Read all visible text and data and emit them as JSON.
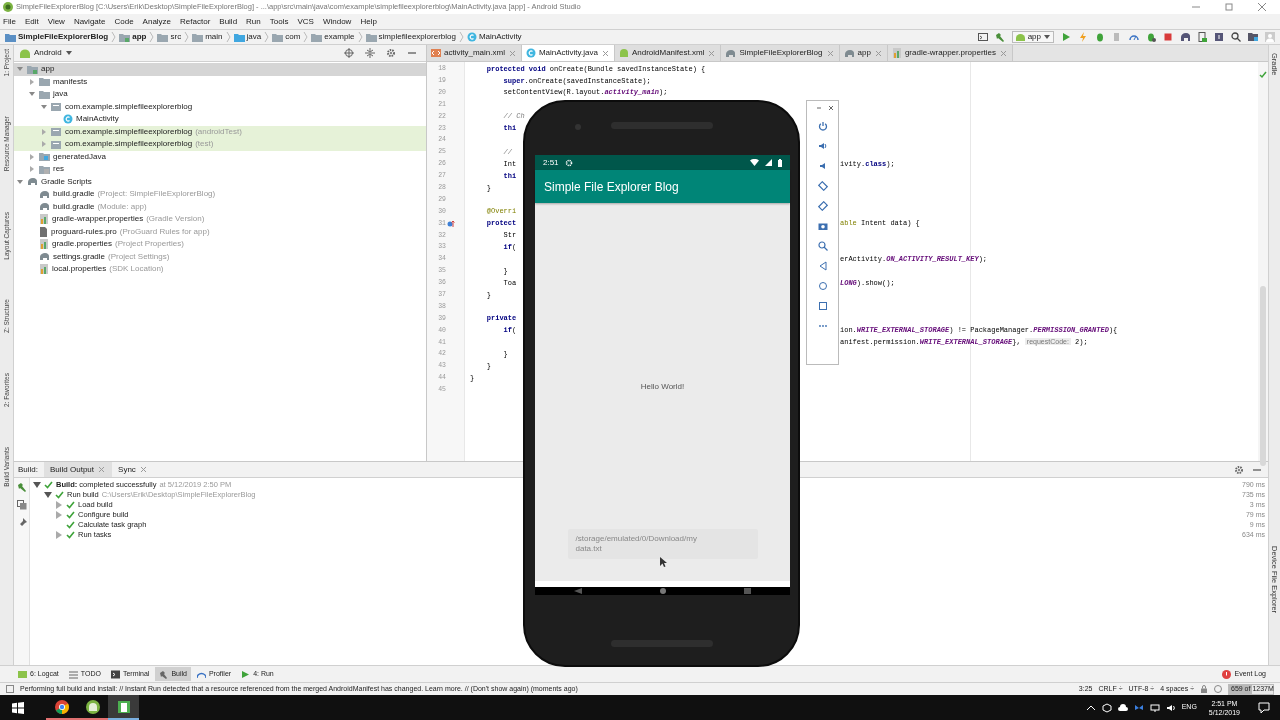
{
  "window": {
    "title": "SimpleFileExplorerBlog [C:\\Users\\Erik\\Desktop\\SimpleFileExplorerBlog] - ...\\app\\src\\main\\java\\com\\example\\simplefileexplorerblog\\MainActivity.java [app] - Android Studio"
  },
  "menu": [
    "File",
    "Edit",
    "View",
    "Navigate",
    "Code",
    "Analyze",
    "Refactor",
    "Build",
    "Run",
    "Tools",
    "VCS",
    "Window",
    "Help"
  ],
  "breadcrumb": [
    {
      "label": "SimpleFileExplorerBlog",
      "kind": "project"
    },
    {
      "label": "app",
      "kind": "module"
    },
    {
      "label": "src",
      "kind": "folder"
    },
    {
      "label": "main",
      "kind": "folder"
    },
    {
      "label": "java",
      "kind": "source"
    },
    {
      "label": "com",
      "kind": "folder"
    },
    {
      "label": "example",
      "kind": "folder"
    },
    {
      "label": "simplefileexplorerblog",
      "kind": "folder"
    },
    {
      "label": "MainActivity",
      "kind": "class"
    }
  ],
  "run_config": "app",
  "left_strip": [
    "1: Project",
    "Resource Manager",
    "Layout Captures",
    "Z: Structure",
    "2: Favorites",
    "Build Variants"
  ],
  "right_strip": [
    "Gradle",
    "Device File Explorer"
  ],
  "project": {
    "view": "Android",
    "tree": [
      {
        "label": "app",
        "kind": "module",
        "selected": true,
        "highlighted": false,
        "expanded": true,
        "children": [
          {
            "label": "manifests",
            "kind": "folder",
            "selected": false,
            "highlighted": false,
            "expanded": false
          },
          {
            "label": "java",
            "kind": "folder",
            "selected": false,
            "highlighted": false,
            "expanded": true,
            "children": [
              {
                "label": "com.example.simplefileexplorerblog",
                "kind": "package",
                "selected": false,
                "highlighted": false,
                "expanded": true,
                "children": [
                  {
                    "label": "MainActivity",
                    "kind": "class",
                    "selected": false,
                    "highlighted": false
                  }
                ]
              },
              {
                "label": "com.example.simplefileexplorerblog",
                "hint": "(androidTest)",
                "kind": "package",
                "selected": false,
                "highlighted": true,
                "expanded": false
              },
              {
                "label": "com.example.simplefileexplorerblog",
                "hint": "(test)",
                "kind": "package",
                "selected": false,
                "highlighted": true,
                "expanded": false
              }
            ]
          },
          {
            "label": "generatedJava",
            "kind": "generated",
            "selected": false,
            "highlighted": false,
            "expanded": false
          },
          {
            "label": "res",
            "kind": "res",
            "selected": false,
            "highlighted": false,
            "expanded": false
          }
        ]
      },
      {
        "label": "Gradle Scripts",
        "kind": "gradle",
        "selected": false,
        "highlighted": false,
        "expanded": true,
        "children": [
          {
            "label": "build.gradle",
            "hint": "(Project: SimpleFileExplorerBlog)",
            "kind": "gradle",
            "selected": false,
            "highlighted": false
          },
          {
            "label": "build.gradle",
            "hint": "(Module: app)",
            "kind": "gradle",
            "selected": false,
            "highlighted": false
          },
          {
            "label": "gradle-wrapper.properties",
            "hint": "(Gradle Version)",
            "kind": "properties",
            "selected": false,
            "highlighted": false
          },
          {
            "label": "proguard-rules.pro",
            "hint": "(ProGuard Rules for app)",
            "kind": "file",
            "selected": false,
            "highlighted": false
          },
          {
            "label": "gradle.properties",
            "hint": "(Project Properties)",
            "kind": "properties",
            "selected": false,
            "highlighted": false
          },
          {
            "label": "settings.gradle",
            "hint": "(Project Settings)",
            "kind": "gradle",
            "selected": false,
            "highlighted": false
          },
          {
            "label": "local.properties",
            "hint": "(SDK Location)",
            "kind": "properties",
            "selected": false,
            "highlighted": false
          }
        ]
      }
    ]
  },
  "editor_tabs": [
    {
      "label": "activity_main.xml",
      "kind": "xml",
      "selected": false
    },
    {
      "label": "MainActivity.java",
      "kind": "class",
      "selected": true
    },
    {
      "label": "AndroidManifest.xml",
      "kind": "manifest",
      "selected": false
    },
    {
      "label": "SimpleFileExplorerBlog",
      "kind": "gradle",
      "selected": false
    },
    {
      "label": "app",
      "kind": "gradle",
      "selected": false
    },
    {
      "label": "gradle-wrapper.properties",
      "kind": "properties",
      "selected": false
    }
  ],
  "code": [
    {
      "num": "18",
      "override": false,
      "left": [
        {
          "text": "    protected void ",
          "kind": "keyword"
        },
        {
          "text": "onCreate(Bundle savedInstanceState) {",
          "kind": "plain"
        }
      ]
    },
    {
      "num": "19",
      "override": false,
      "left": [
        {
          "text": "        super",
          "kind": "keyword"
        },
        {
          "text": ".onCreate(savedInstanceState);",
          "kind": "plain"
        }
      ]
    },
    {
      "num": "20",
      "override": false,
      "left": [
        {
          "text": "        setContentView(R.layout.",
          "kind": "plain"
        },
        {
          "text": "activity_main",
          "kind": "constant"
        },
        {
          "text": ");",
          "kind": "plain"
        }
      ]
    },
    {
      "num": "21",
      "override": false
    },
    {
      "num": "22",
      "override": false,
      "left": [
        {
          "text": "        // Ch",
          "kind": "comment"
        }
      ]
    },
    {
      "num": "23",
      "override": false,
      "left": [
        {
          "text": "        thi",
          "kind": "keyword"
        }
      ]
    },
    {
      "num": "24",
      "override": false
    },
    {
      "num": "25",
      "override": false,
      "left": [
        {
          "text": "        //",
          "kind": "comment"
        }
      ]
    },
    {
      "num": "26",
      "override": false,
      "left": [
        {
          "text": "        Int",
          "kind": "plain"
        }
      ],
      "right": [
        {
          "text": "ivity.",
          "kind": "plain"
        },
        {
          "text": "class",
          "kind": "keyword"
        },
        {
          "text": ");",
          "kind": "plain"
        }
      ]
    },
    {
      "num": "27",
      "override": false,
      "left": [
        {
          "text": "        thi",
          "kind": "keyword"
        }
      ]
    },
    {
      "num": "28",
      "override": false,
      "left": [
        {
          "text": "    }",
          "kind": "plain"
        }
      ]
    },
    {
      "num": "29",
      "override": false
    },
    {
      "num": "30",
      "override": false,
      "left": [
        {
          "text": "    @Overri",
          "kind": "annotation"
        }
      ]
    },
    {
      "num": "31",
      "override": true,
      "left": [
        {
          "text": "    protect",
          "kind": "keyword"
        }
      ],
      "right": [
        {
          "text": "able",
          "kind": "annotation"
        },
        {
          "text": " Intent data) {",
          "kind": "plain"
        }
      ]
    },
    {
      "num": "32",
      "override": false,
      "left": [
        {
          "text": "        Str",
          "kind": "plain"
        }
      ]
    },
    {
      "num": "33",
      "override": false,
      "left": [
        {
          "text": "        if",
          "kind": "keyword"
        },
        {
          "text": "(",
          "kind": "plain"
        }
      ]
    },
    {
      "num": "34",
      "override": false,
      "right": [
        {
          "text": "erActivity.",
          "kind": "plain"
        },
        {
          "text": "ON_ACTIVITY_RESULT_KEY",
          "kind": "constant"
        },
        {
          "text": ");",
          "kind": "plain"
        }
      ]
    },
    {
      "num": "35",
      "override": false,
      "left": [
        {
          "text": "        }",
          "kind": "plain"
        }
      ]
    },
    {
      "num": "36",
      "override": false,
      "left": [
        {
          "text": "        Toa",
          "kind": "plain"
        }
      ],
      "right": [
        {
          "text": "LONG",
          "kind": "constant"
        },
        {
          "text": ").show();",
          "kind": "plain"
        }
      ]
    },
    {
      "num": "37",
      "override": false,
      "left": [
        {
          "text": "    }",
          "kind": "plain"
        }
      ]
    },
    {
      "num": "38",
      "override": false
    },
    {
      "num": "39",
      "override": false,
      "left": [
        {
          "text": "    private",
          "kind": "keyword"
        }
      ]
    },
    {
      "num": "40",
      "override": false,
      "left": [
        {
          "text": "        if",
          "kind": "keyword"
        },
        {
          "text": "(",
          "kind": "plain"
        }
      ],
      "right": [
        {
          "text": "ion.",
          "kind": "plain"
        },
        {
          "text": "WRITE_EXTERNAL_STORAGE",
          "kind": "constant"
        },
        {
          "text": ") != PackageManager.",
          "kind": "plain"
        },
        {
          "text": "PERMISSION_GRANTED",
          "kind": "constant"
        },
        {
          "text": "){",
          "kind": "plain"
        }
      ]
    },
    {
      "num": "41",
      "override": false,
      "right": [
        {
          "text": "anifest.permission.",
          "kind": "plain"
        },
        {
          "text": "WRITE_EXTERNAL_STORAGE",
          "kind": "constant"
        },
        {
          "text": "}, ",
          "kind": "plain"
        },
        {
          "text": "requestCode:",
          "kind": "hint"
        },
        {
          "text": " 2);",
          "kind": "plain"
        }
      ]
    },
    {
      "num": "42",
      "override": false,
      "left": [
        {
          "text": "        }",
          "kind": "plain"
        }
      ]
    },
    {
      "num": "43",
      "override": false,
      "left": [
        {
          "text": "    }",
          "kind": "plain"
        }
      ]
    },
    {
      "num": "44",
      "override": false,
      "left": [
        {
          "text": "}",
          "kind": "plain"
        }
      ]
    },
    {
      "num": "45",
      "override": false
    }
  ],
  "phone": {
    "time": "2:51",
    "app_title": "Simple File Explorer Blog",
    "body": "Hello World!",
    "toast": "/storage/emulated/0/Download/my data.txt"
  },
  "build": {
    "label": "Build:",
    "tabs": [
      {
        "label": "Build Output",
        "selected": true
      },
      {
        "label": "Sync",
        "selected": false
      }
    ],
    "tree": [
      {
        "text": "**Build:** completed successfully",
        "hint": "at 5/12/2019 2:50 PM",
        "time": "790 ms",
        "expanded": true,
        "children": [
          {
            "text": "Run build",
            "hint": "C:\\Users\\Erik\\Desktop\\SimpleFileExplorerBlog",
            "time": "735 ms",
            "expanded": true,
            "children": [
              {
                "text": "Load build",
                "time": "3 ms",
                "expanded": false
              },
              {
                "text": "Configure build",
                "time": "79 ms",
                "expanded": false
              },
              {
                "text": "Calculate task graph",
                "time": "9 ms"
              },
              {
                "text": "Run tasks",
                "time": "634 ms",
                "expanded": false
              }
            ]
          }
        ]
      }
    ]
  },
  "tool_windows": [
    {
      "label": "6: Logcat",
      "kind": "logcat",
      "selected": false
    },
    {
      "label": "TODO",
      "kind": "todo",
      "selected": false
    },
    {
      "label": "Terminal",
      "kind": "terminal",
      "selected": false
    },
    {
      "label": "Build",
      "kind": "build",
      "selected": true
    },
    {
      "label": "Profiler",
      "kind": "profiler",
      "selected": false
    },
    {
      "label": "4: Run",
      "kind": "run",
      "selected": false
    }
  ],
  "event_log": "Event Log",
  "status": {
    "message": "Performing full build and install: // Instant Run detected that a resource referenced from the merged AndroidManifest has changed. Learn more. // (Don't show again) (moments ago)",
    "position": "3:25",
    "line_sep": "CRLF ÷",
    "encoding": "UTF-8 ÷",
    "indent": "4 spaces ÷",
    "memory": {
      "text": "659 of 1237M",
      "level": 0.53
    }
  },
  "taskbar": {
    "apps": [
      {
        "kind": "chrome",
        "selected": false
      },
      {
        "kind": "android",
        "selected": false
      },
      {
        "kind": "app",
        "selected": true
      }
    ],
    "lang": "ENG",
    "time": "2:51 PM",
    "date": "5/12/2019"
  }
}
